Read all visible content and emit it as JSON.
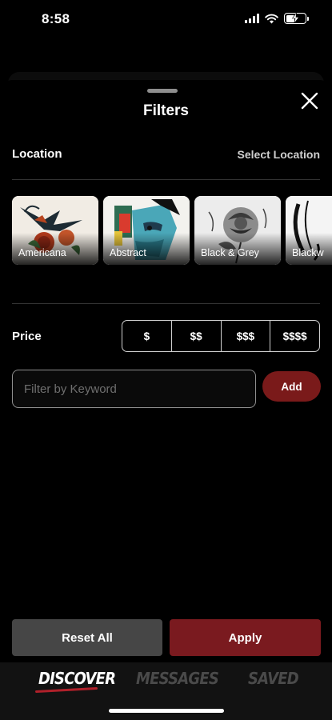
{
  "status_bar": {
    "time": "8:58",
    "icons": [
      "signal-icon",
      "wifi-icon",
      "battery-charging-icon"
    ],
    "battery_level": 0.45
  },
  "sheet": {
    "title": "Filters",
    "close_icon": "close-icon"
  },
  "location": {
    "label": "Location",
    "select_label": "Select Location"
  },
  "styles": [
    {
      "label": "Americana"
    },
    {
      "label": "Abstract"
    },
    {
      "label": "Black & Grey"
    },
    {
      "label": "Blackw"
    }
  ],
  "price": {
    "label": "Price",
    "options": [
      "$",
      "$$",
      "$$$",
      "$$$$"
    ]
  },
  "keyword": {
    "placeholder": "Filter by Keyword",
    "value": "",
    "add_label": "Add"
  },
  "actions": {
    "reset_label": "Reset All",
    "apply_label": "Apply"
  },
  "tabs": [
    {
      "label": "DISCOVER",
      "active": true
    },
    {
      "label": "MESSAGES",
      "active": false
    },
    {
      "label": "SAVED",
      "active": false
    }
  ],
  "colors": {
    "accent": "#7a1a1a",
    "active_tab_underline": "#b0202a",
    "background": "#000000"
  }
}
